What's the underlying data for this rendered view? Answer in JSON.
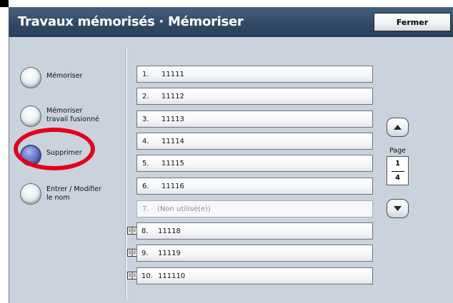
{
  "header": {
    "title": "Travaux mémorisés · Mémoriser",
    "close_label": "Fermer"
  },
  "options": [
    {
      "label": "Mémoriser",
      "selected": false
    },
    {
      "label": "Mémoriser\ntravail fusionné",
      "selected": false
    },
    {
      "label": "Supprimer",
      "selected": true
    },
    {
      "label": "Entrer / Modifier\nle nom",
      "selected": false
    }
  ],
  "jobs": [
    {
      "num": "1.",
      "name": "11111",
      "unused": false,
      "book_icon": false
    },
    {
      "num": "2.",
      "name": "11112",
      "unused": false,
      "book_icon": false
    },
    {
      "num": "3.",
      "name": "11113",
      "unused": false,
      "book_icon": false
    },
    {
      "num": "4.",
      "name": "11114",
      "unused": false,
      "book_icon": false
    },
    {
      "num": "5.",
      "name": "11115",
      "unused": false,
      "book_icon": false
    },
    {
      "num": "6.",
      "name": "11116",
      "unused": false,
      "book_icon": false
    },
    {
      "num": "7.",
      "name": "(Non utilisé(e))",
      "unused": true,
      "book_icon": false
    },
    {
      "num": "8.",
      "name": "11118",
      "unused": false,
      "book_icon": true
    },
    {
      "num": "9.",
      "name": "11119",
      "unused": false,
      "book_icon": true
    },
    {
      "num": "10.",
      "name": "111110",
      "unused": false,
      "book_icon": true
    }
  ],
  "pager": {
    "label": "Page",
    "current": "1",
    "total": "4",
    "up_icon": "triangle-up-icon",
    "down_icon": "triangle-down-icon"
  },
  "colors": {
    "header_bg": "#324a66",
    "panel_bg": "#cad3dd",
    "selected_radio": "#4a5cb8",
    "annotation_red": "#e4001b"
  }
}
